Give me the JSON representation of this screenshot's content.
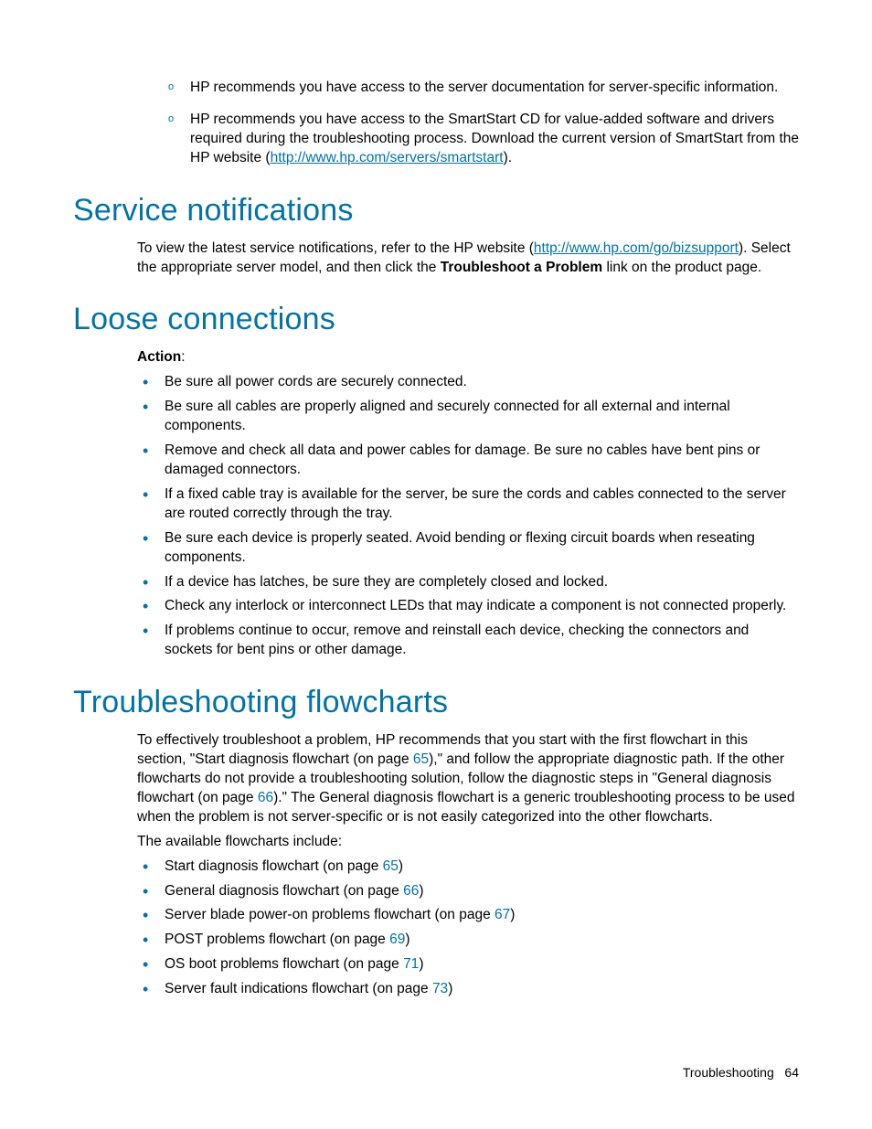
{
  "topList": [
    "HP recommends you have access to the server documentation for server-specific information.",
    "HP recommends you have access to the SmartStart CD for value-added software and drivers required during the troubleshooting process. Download the current version of SmartStart from the HP website ("
  ],
  "topListLink": "http://www.hp.com/servers/smartstart",
  "topListTail": ").",
  "svcHeading": "Service notifications",
  "svcPara1a": "To view the latest service notifications, refer to the HP website (",
  "svcLink": "http://www.hp.com/go/bizsupport",
  "svcPara1b": "). Select the appropriate server model, and then click the ",
  "svcBold": "Troubleshoot a Problem",
  "svcPara1c": " link on the product page.",
  "looseHeading": "Loose connections",
  "actionLabel": "Action",
  "actionColon": ":",
  "looseItems": [
    "Be sure all power cords are securely connected.",
    "Be sure all cables are properly aligned and securely connected for all external and internal components.",
    "Remove and check all data and power cables for damage. Be sure no cables have bent pins or damaged connectors.",
    "If a fixed cable tray is available for the server, be sure the cords and cables connected to the server are routed correctly through the tray.",
    "Be sure each device is properly seated. Avoid bending or flexing circuit boards when reseating components.",
    "If a device has latches, be sure they are completely closed and locked.",
    "Check any interlock or interconnect LEDs that may indicate a component is not connected properly.",
    "If problems continue to occur, remove and reinstall each device, checking the connectors and sockets for bent pins or other damage."
  ],
  "flowHeading": "Troubleshooting flowcharts",
  "flowPara1a": "To effectively troubleshoot a problem, HP recommends that you start with the first flowchart in this section, \"Start diagnosis flowchart (on page ",
  "flowPg1": "65",
  "flowPara1b": "),\" and follow the appropriate diagnostic path. If the other flowcharts do not provide a troubleshooting solution, follow the diagnostic steps in \"General diagnosis flowchart (on page ",
  "flowPg2": "66",
  "flowPara1c": ").\" The General diagnosis flowchart is a generic troubleshooting process to be used when the problem is not server-specific or is not easily categorized into the other flowcharts.",
  "flowPara2": "The available flowcharts include:",
  "flowItems": [
    {
      "pre": "Start diagnosis flowchart (on page ",
      "pg": "65",
      "post": ")"
    },
    {
      "pre": "General diagnosis flowchart (on page ",
      "pg": "66",
      "post": ")"
    },
    {
      "pre": "Server blade power-on problems flowchart (on page ",
      "pg": "67",
      "post": ")"
    },
    {
      "pre": "POST problems flowchart (on page ",
      "pg": "69",
      "post": ")"
    },
    {
      "pre": "OS boot problems flowchart (on page ",
      "pg": "71",
      "post": ")"
    },
    {
      "pre": "Server fault indications flowchart (on page ",
      "pg": "73",
      "post": ")"
    }
  ],
  "footerSection": "Troubleshooting",
  "footerPage": "64"
}
